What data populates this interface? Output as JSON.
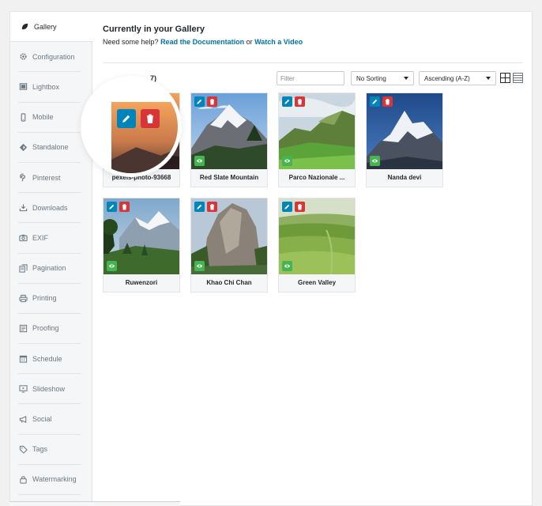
{
  "sidebar": {
    "items": [
      {
        "label": "Gallery",
        "icon": "leaf-icon",
        "active": true
      },
      {
        "label": "Configuration",
        "icon": "gear-icon",
        "active": false
      },
      {
        "label": "Lightbox",
        "icon": "lightbox-icon",
        "active": false
      },
      {
        "label": "Mobile",
        "icon": "mobile-icon",
        "active": false
      },
      {
        "label": "Standalone",
        "icon": "standalone-icon",
        "active": false
      },
      {
        "label": "Pinterest",
        "icon": "pinterest-icon",
        "active": false
      },
      {
        "label": "Downloads",
        "icon": "download-icon",
        "active": false
      },
      {
        "label": "EXIF",
        "icon": "camera-icon",
        "active": false
      },
      {
        "label": "Pagination",
        "icon": "pagination-icon",
        "active": false
      },
      {
        "label": "Printing",
        "icon": "printer-icon",
        "active": false
      },
      {
        "label": "Proofing",
        "icon": "proofing-icon",
        "active": false
      },
      {
        "label": "Schedule",
        "icon": "calendar-icon",
        "active": false
      },
      {
        "label": "Slideshow",
        "icon": "slideshow-icon",
        "active": false
      },
      {
        "label": "Social",
        "icon": "megaphone-icon",
        "active": false
      },
      {
        "label": "Tags",
        "icon": "tag-icon",
        "active": false
      },
      {
        "label": "Watermarking",
        "icon": "lock-icon",
        "active": false
      }
    ]
  },
  "main": {
    "title": "Currently in your Gallery",
    "help_prefix": "Need some help?",
    "help_link_docs": "Read the Documentation",
    "help_or": "or",
    "help_link_video": "Watch a Video",
    "count_text": "7)",
    "filter_placeholder": "Filter",
    "sort_value": "No Sorting",
    "order_value": "Ascending (A-Z)"
  },
  "images": [
    {
      "caption": "pexels-photo-93668",
      "icon": "edit-icon"
    },
    {
      "caption": "Red Slate Mountain",
      "icon": "edit-icon"
    },
    {
      "caption": "Parco Nazionale ...",
      "icon": "edit-icon"
    },
    {
      "caption": "Nanda devi",
      "icon": "edit-icon"
    },
    {
      "caption": "Ruwenzori",
      "icon": "edit-icon"
    },
    {
      "caption": "Khao Chi Chan",
      "icon": "edit-icon"
    },
    {
      "caption": "Green Valley",
      "icon": "edit-icon"
    }
  ],
  "colors": {
    "edit": "#0085ba",
    "delete": "#d63638",
    "visible": "#46b450",
    "link": "#0073aa"
  }
}
